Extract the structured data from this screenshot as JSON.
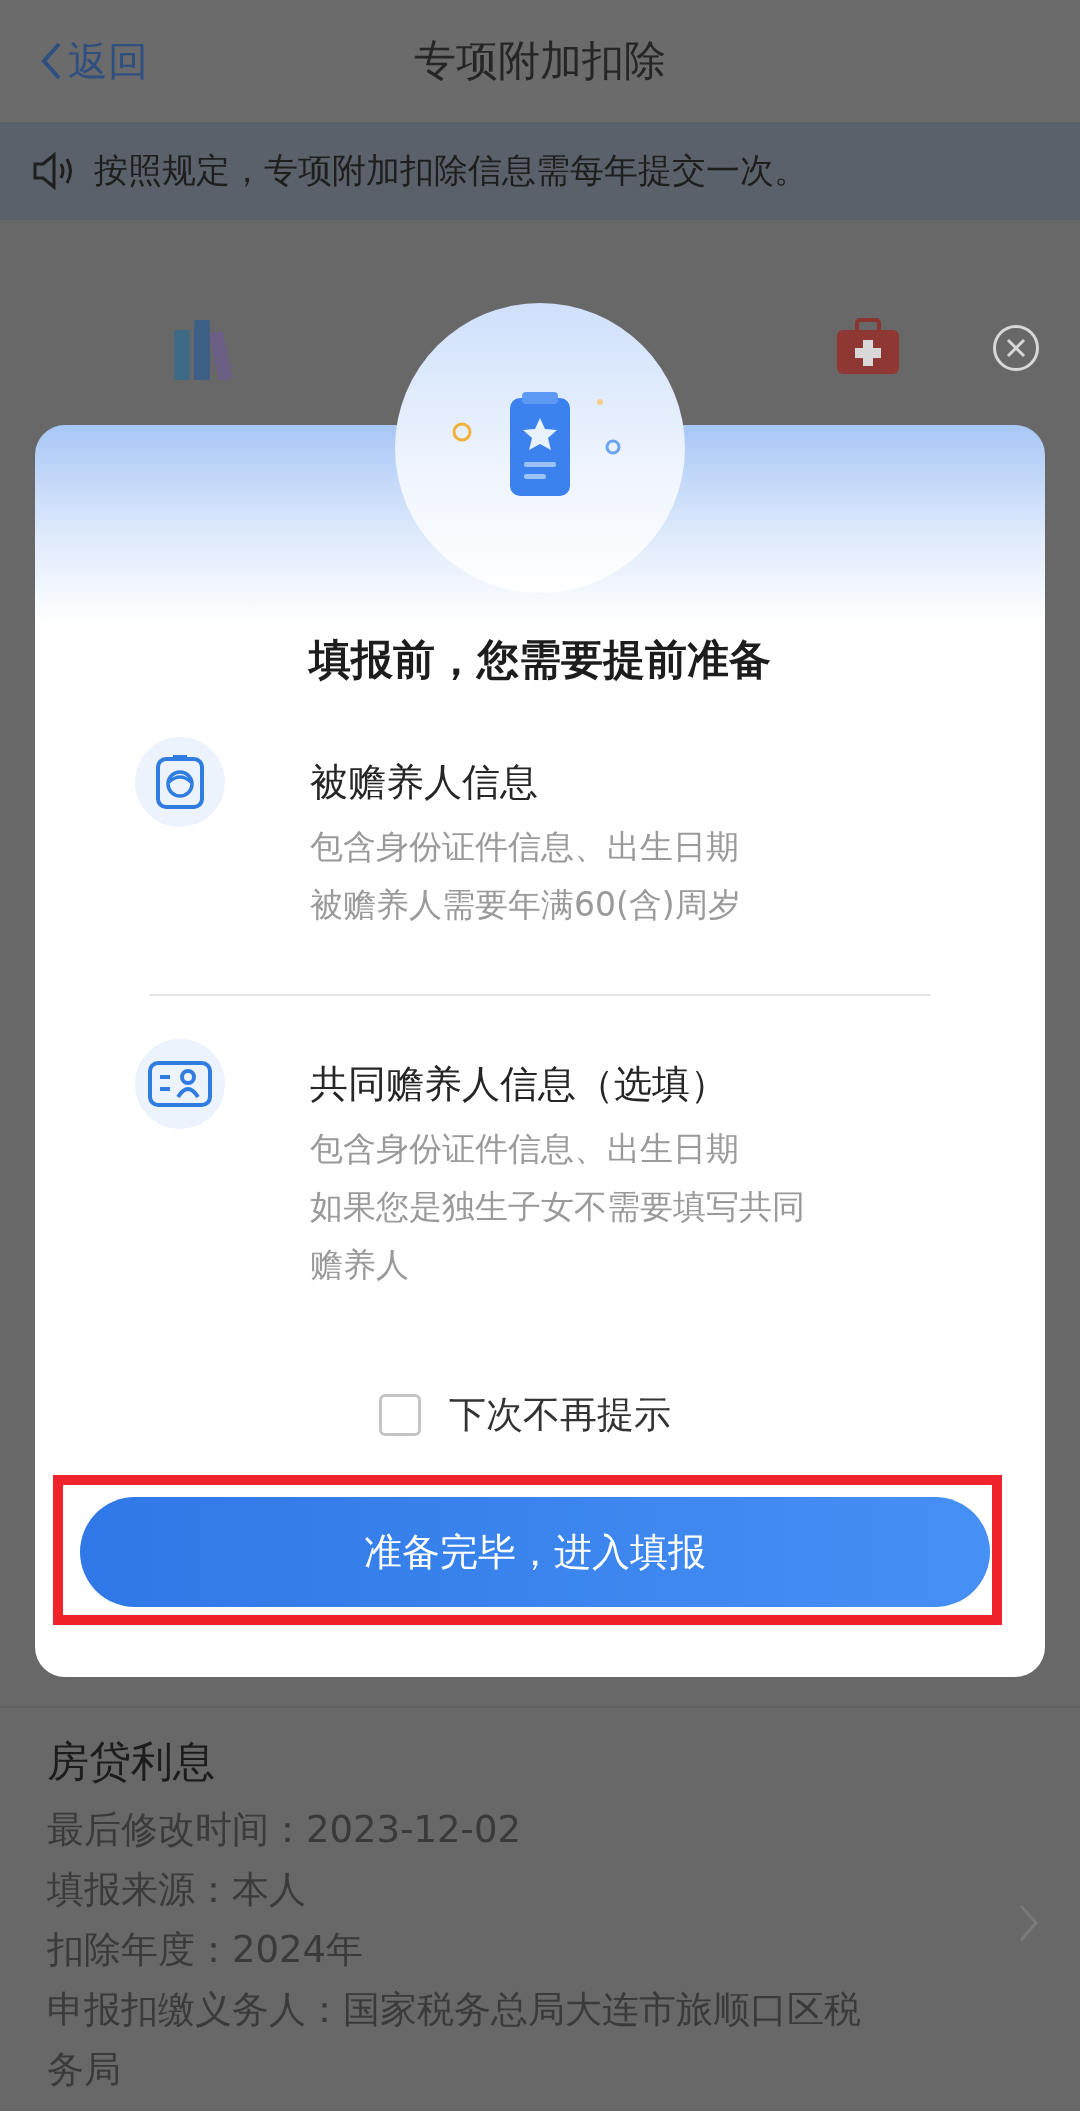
{
  "nav": {
    "back": "返回",
    "title": "专项附加扣除"
  },
  "notice": "按照规定，专项附加扣除信息需每年提交一次。",
  "dialog": {
    "title": "填报前，您需要提前准备",
    "items": [
      {
        "kind": "elder",
        "title": "被赡养人信息",
        "lines": [
          "包含身份证件信息、出生日期",
          "被赡养人需要年满60(含)周岁"
        ]
      },
      {
        "kind": "card",
        "title": "共同赡养人信息（选填）",
        "lines": [
          "包含身份证件信息、出生日期",
          "如果您是独生子女不需要填写共同赡养人"
        ]
      }
    ],
    "checkbox": {
      "label": "下次不再提示",
      "checked": false
    },
    "button": "准备完毕，进入填报",
    "highlighted": true
  },
  "record": {
    "title": "房贷利息",
    "lines": [
      "最后修改时间：2023-12-02",
      "填报来源：本人",
      "扣除年度：2024年",
      "申报扣缴义务人：国家税务总局大连市旅顺口区税务局"
    ]
  }
}
